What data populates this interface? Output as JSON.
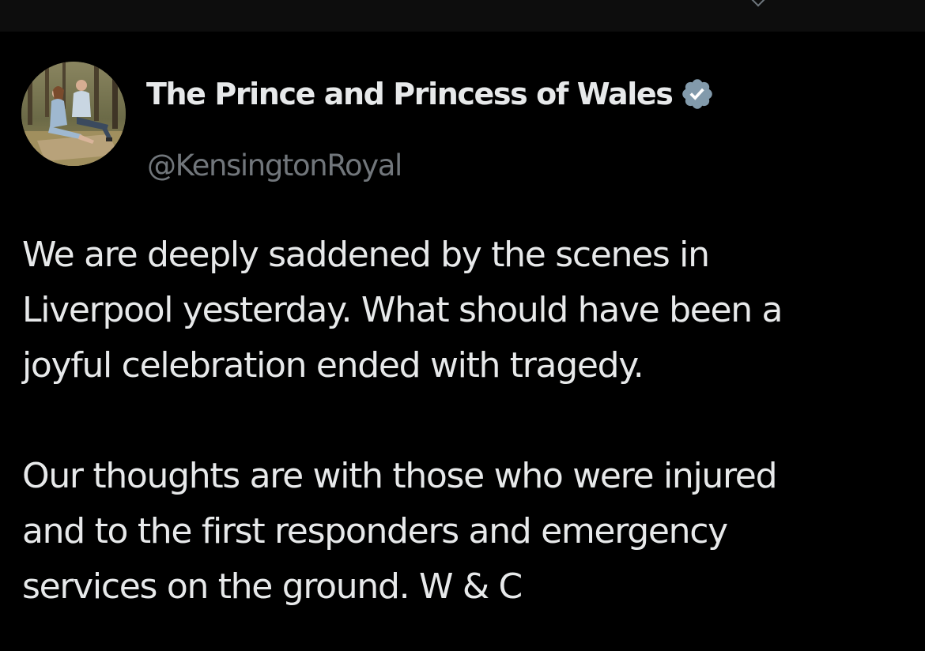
{
  "tweet": {
    "author_name": "The Prince and Princess of Wales",
    "handle": "@KensingtonRoyal",
    "verified": true,
    "avatar_icon": "profile-photo",
    "verified_icon": "verified-badge-icon",
    "paragraph1": [
      "We are deeply saddened by the scenes in",
      "Liverpool yesterday. What should have been a",
      "joyful celebration ended with tragedy."
    ],
    "paragraph2": [
      "Our thoughts are with those who were injured",
      "and to the first responders and emergency",
      "services on the ground. W & C"
    ]
  },
  "colors": {
    "background": "#000000",
    "text_primary": "#e7e9ea",
    "text_secondary": "#71767b",
    "verified_badge": "#829aab"
  }
}
